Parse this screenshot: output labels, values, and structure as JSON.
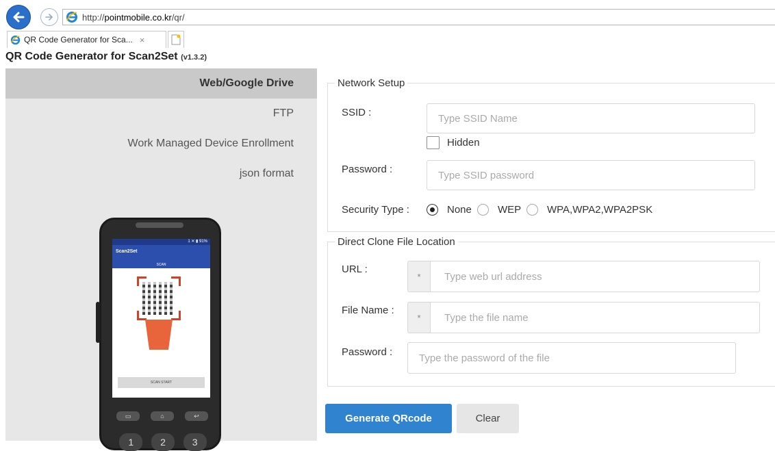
{
  "browser": {
    "url_prefix": "http://",
    "url_domain": "pointmobile.co.kr",
    "url_path": "/qr/",
    "tab_title": "QR Code Generator for Sca...",
    "tab_close": "×"
  },
  "page": {
    "title": "QR Code Generator for Scan2Set",
    "version": "(v1.3.2)"
  },
  "sidebar": {
    "items": [
      {
        "label": "Web/Google Drive",
        "active": true
      },
      {
        "label": "FTP",
        "active": false
      },
      {
        "label": "Work Managed Device Enrollment",
        "active": false
      },
      {
        "label": "json format",
        "active": false
      }
    ]
  },
  "phone": {
    "status": "1 ✕  ▮ 91%",
    "app_title": "Scan2Set",
    "scan_tab": "SCAN",
    "scan_button": "SCAN START",
    "keys": [
      "▭",
      "⌂",
      "↩"
    ],
    "num_keys": [
      "1",
      "2",
      "3"
    ]
  },
  "network": {
    "legend": "Network Setup",
    "ssid_label": "SSID :",
    "ssid_placeholder": "Type SSID Name",
    "hidden_label": "Hidden",
    "password_label": "Password :",
    "password_placeholder": "Type SSID password",
    "security_label": "Security Type :",
    "security_options": [
      "None",
      "WEP",
      "WPA,WPA2,WPA2PSK"
    ],
    "security_selected": "None"
  },
  "clone": {
    "legend": "Direct Clone File Location",
    "url_label": "URL :",
    "url_placeholder": "Type web url address",
    "file_label": "File Name :",
    "file_placeholder": "Type the file name",
    "password_label": "Password :",
    "password_placeholder": "Type the password of the file",
    "required_marker": "*"
  },
  "actions": {
    "generate": "Generate QRcode",
    "clear": "Clear"
  },
  "colors": {
    "primary": "#2f83cf",
    "sidebar_bg": "#e7e7e7",
    "sidebar_active": "#c9c9c9"
  }
}
